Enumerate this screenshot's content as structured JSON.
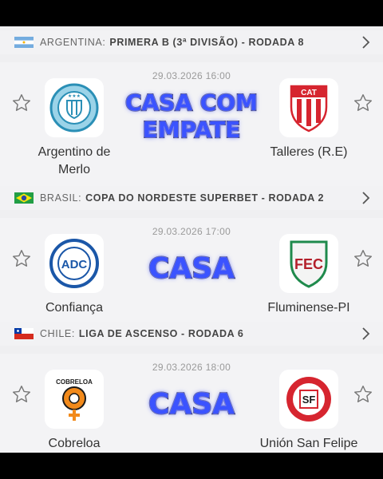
{
  "matches": [
    {
      "country": "ARGENTINA:",
      "competition": "PRIMERA B (3ª DIVISÃO) - RODADA 8",
      "datetime": "29.03.2026 16:00",
      "home": "Argentino de Merlo",
      "away": "Talleres (R.E)",
      "tip": "CASA COM EMPATE",
      "tip_line1": "CASA COM",
      "tip_line2": "EMPATE"
    },
    {
      "country": "BRASIL:",
      "competition": "COPA DO NORDESTE SUPERBET - RODADA 2",
      "datetime": "29.03.2026 17:00",
      "home": "Confiança",
      "away": "Fluminense-PI",
      "tip": "CASA"
    },
    {
      "country": "CHILE:",
      "competition": "LIGA DE ASCENSO - RODADA 6",
      "datetime": "29.03.2026 18:00",
      "home": "Cobreloa",
      "away": "Unión San Felipe",
      "tip": "CASA"
    }
  ],
  "icons": {
    "star": "star-outline-icon",
    "chevron": "chevron-right-icon"
  },
  "colors": {
    "tip_fill": "#3b53ff",
    "tip_outline": "#1a1a4a",
    "background": "#efeff1"
  }
}
